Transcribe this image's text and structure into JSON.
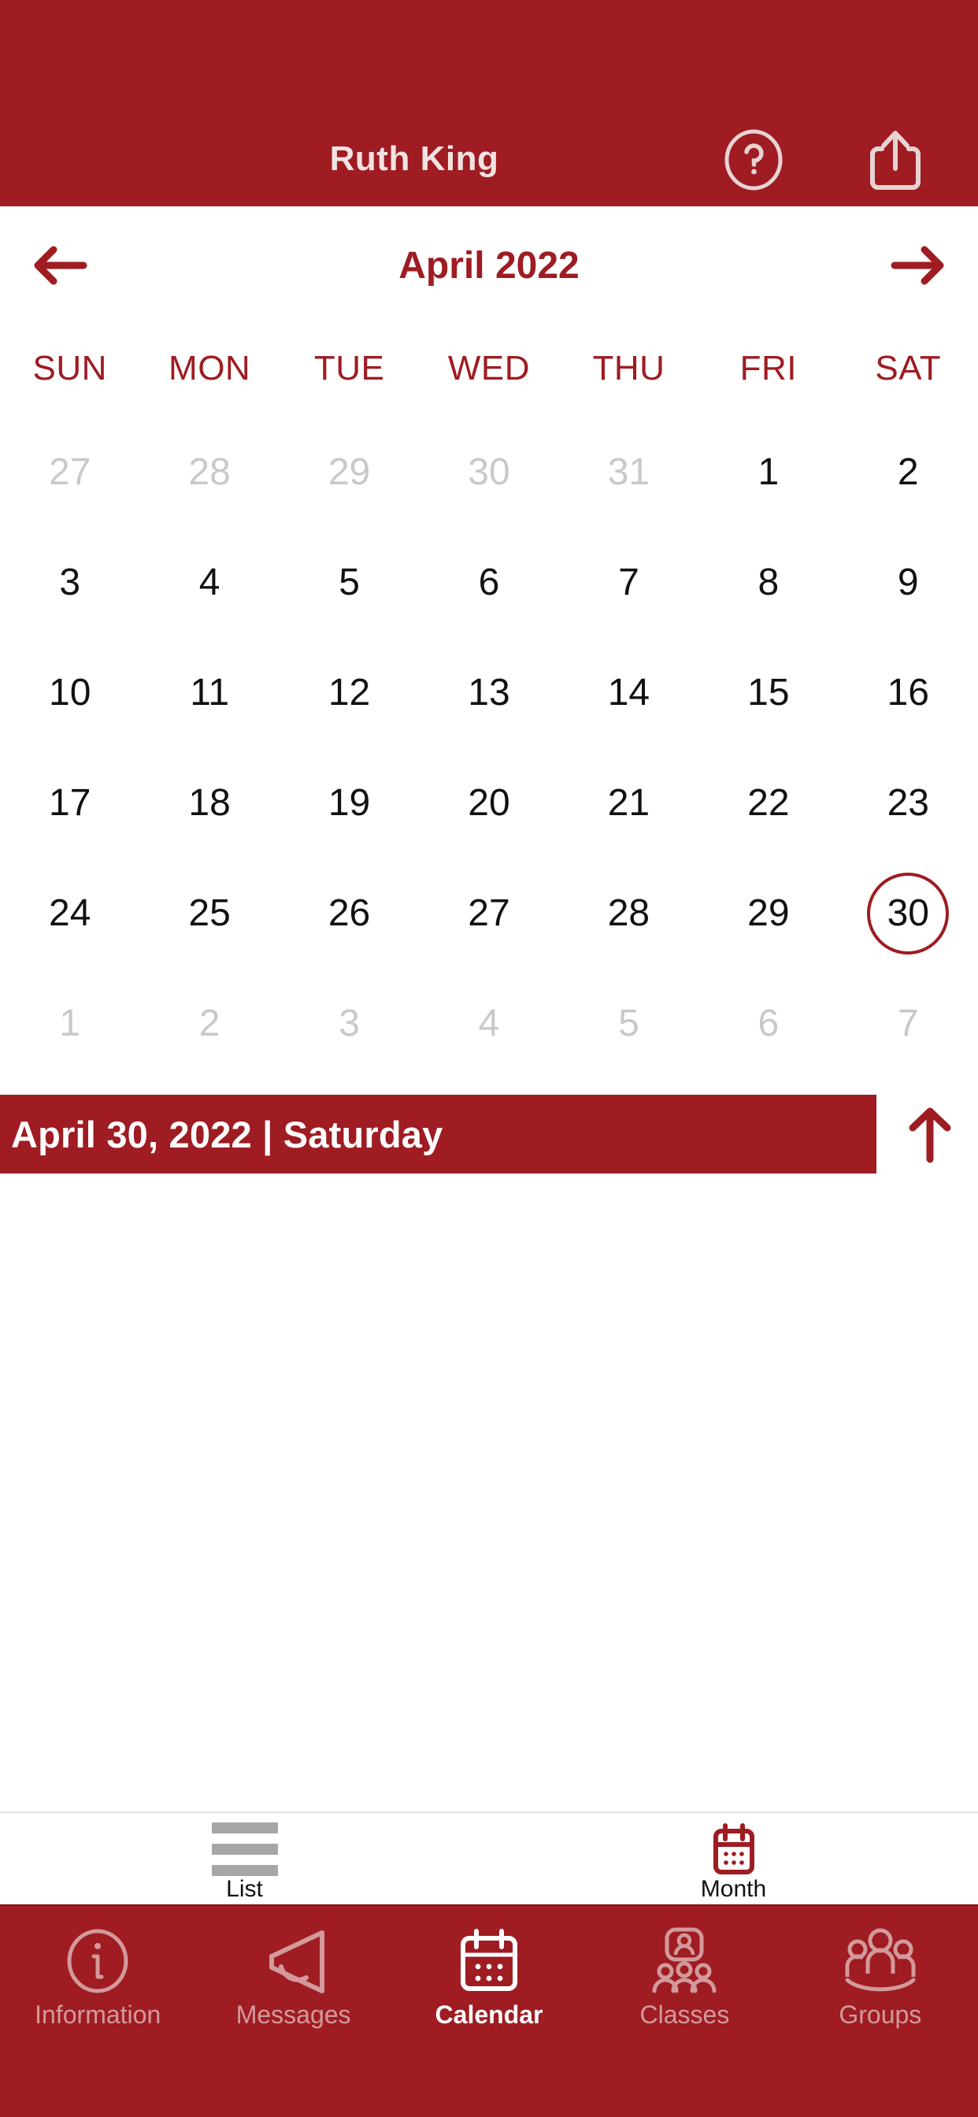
{
  "header": {
    "title": "Ruth King",
    "help_icon": "question-circle-icon",
    "share_icon": "share-upload-icon",
    "background_color": "#9e1c22",
    "text_color": "#f2e3e3"
  },
  "month_nav": {
    "prev_icon": "arrow-left-icon",
    "next_icon": "arrow-right-icon",
    "month_label": "April 2022",
    "accent_color": "#9e1c22"
  },
  "weekdays": [
    "SUN",
    "MON",
    "TUE",
    "WED",
    "THU",
    "FRI",
    "SAT"
  ],
  "calendar": {
    "selected_day": 30,
    "muted_color": "#c9c9c9",
    "active_color": "#111111",
    "selection_ring_color": "#9e1c22",
    "weeks": [
      [
        {
          "num": "27",
          "muted": true
        },
        {
          "num": "28",
          "muted": true
        },
        {
          "num": "29",
          "muted": true
        },
        {
          "num": "30",
          "muted": true
        },
        {
          "num": "31",
          "muted": true
        },
        {
          "num": "1",
          "muted": false
        },
        {
          "num": "2",
          "muted": false
        }
      ],
      [
        {
          "num": "3",
          "muted": false
        },
        {
          "num": "4",
          "muted": false
        },
        {
          "num": "5",
          "muted": false
        },
        {
          "num": "6",
          "muted": false
        },
        {
          "num": "7",
          "muted": false
        },
        {
          "num": "8",
          "muted": false
        },
        {
          "num": "9",
          "muted": false
        }
      ],
      [
        {
          "num": "10",
          "muted": false
        },
        {
          "num": "11",
          "muted": false
        },
        {
          "num": "12",
          "muted": false
        },
        {
          "num": "13",
          "muted": false
        },
        {
          "num": "14",
          "muted": false
        },
        {
          "num": "15",
          "muted": false
        },
        {
          "num": "16",
          "muted": false
        }
      ],
      [
        {
          "num": "17",
          "muted": false
        },
        {
          "num": "18",
          "muted": false
        },
        {
          "num": "19",
          "muted": false
        },
        {
          "num": "20",
          "muted": false
        },
        {
          "num": "21",
          "muted": false
        },
        {
          "num": "22",
          "muted": false
        },
        {
          "num": "23",
          "muted": false
        }
      ],
      [
        {
          "num": "24",
          "muted": false
        },
        {
          "num": "25",
          "muted": false
        },
        {
          "num": "26",
          "muted": false
        },
        {
          "num": "27",
          "muted": false
        },
        {
          "num": "28",
          "muted": false
        },
        {
          "num": "29",
          "muted": false
        },
        {
          "num": "30",
          "muted": false,
          "selected": true
        }
      ],
      [
        {
          "num": "1",
          "muted": true
        },
        {
          "num": "2",
          "muted": true
        },
        {
          "num": "3",
          "muted": true
        },
        {
          "num": "4",
          "muted": true
        },
        {
          "num": "5",
          "muted": true
        },
        {
          "num": "6",
          "muted": true
        },
        {
          "num": "7",
          "muted": true
        }
      ]
    ]
  },
  "selected_date_banner": {
    "text": "April 30, 2022 | Saturday",
    "background_color": "#9e1c22",
    "text_color": "#ffffff",
    "collapse_icon": "arrow-up-icon"
  },
  "view_toggle": {
    "items": [
      {
        "label": "List",
        "icon": "list-lines-icon",
        "active": false
      },
      {
        "label": "Month",
        "icon": "calendar-month-icon",
        "active": true
      }
    ]
  },
  "bottom_nav": {
    "items": [
      {
        "label": "Information",
        "icon": "info-circle-icon",
        "active": false
      },
      {
        "label": "Messages",
        "icon": "megaphone-icon",
        "active": false
      },
      {
        "label": "Calendar",
        "icon": "calendar-icon",
        "active": true
      },
      {
        "label": "Classes",
        "icon": "classroom-icon",
        "active": false
      },
      {
        "label": "Groups",
        "icon": "people-group-icon",
        "active": false
      }
    ],
    "background_color": "#9e1c22"
  }
}
